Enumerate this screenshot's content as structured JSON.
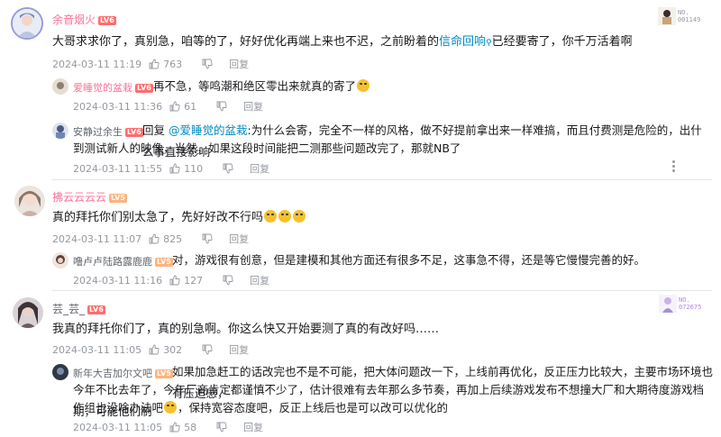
{
  "comments": [
    {
      "username": "余音烟火",
      "level": "LV6",
      "badge_no": "NO.\n001149",
      "text_before": "大哥求求你了，真别急，咱等的了，好好优化再端上来也不迟，之前盼着的",
      "link": "信命回响",
      "text_after": "已经要寄了，你千万活着啊",
      "time": "2024-03-11 11:19",
      "likes": "763",
      "reply": "回复",
      "replies": [
        {
          "username": "爱睡觉的盆栽",
          "level": "LV6",
          "text": "再不急，等鸣潮和绝区零出来就真的寄了",
          "time": "2024-03-11 11:36",
          "likes": "61",
          "reply": "回复"
        },
        {
          "username": "安静过余生",
          "level": "LV6",
          "prefix": "回复 ",
          "mention": "@爱睡觉的盆栽",
          "line1": ":为什么会寄，完全不一样的风格，做不好提前拿出来一样难搞，而且付费测是危险的，出什么事直接影响",
          "line2": "到测试新人的映像，当然，如果这段时间能把二测那些问题改完了，那就NB了",
          "time": "2024-03-11 11:55",
          "likes": "110",
          "reply": "回复"
        }
      ]
    },
    {
      "username": "拂云云云云",
      "level": "LV5",
      "text": "真的拜托你们别太急了，先好好改不行吗",
      "time": "2024-03-11 11:07",
      "likes": "825",
      "reply": "回复",
      "replies": [
        {
          "username": "噜卢卢陆路露鹿鹿",
          "level": "LV5",
          "text": "对，游戏很有创意，但是建模和其他方面还有很多不足，这事急不得，还是等它慢慢完善的好。",
          "time": "2024-03-11 11:16",
          "likes": "127",
          "reply": "回复"
        }
      ]
    },
    {
      "username": "芸_芸_",
      "level": "LV6",
      "badge_no": "NO.\n072675",
      "text": "我真的拜托你们了，真的别急啊。你这么快又开始要测了真的有改好吗……",
      "time": "2024-03-11 11:05",
      "likes": "302",
      "reply": "回复",
      "replies": [
        {
          "username": "新年大吉加尔文吧",
          "level": "LV5",
          "line1": "如果加急赶工的话改完也不是不可能，把大体问题改一下，上线前再优化，反正压力比较大，主要市场环境也有压迫感，",
          "line2": "今年不比去年了，今年厂商肯定都谨慎不少了，估计很难有去年那么多节奏，再加上后续游戏发布不想撞大厂和大期待度游戏档期，可能他们制",
          "line3_before": "作组也没啥办法吧",
          "line3_after": "，保持宽容态度吧，反正上线后也是可以改可以优化的",
          "time": "2024-03-11 11:05",
          "likes": "58",
          "reply": "回复"
        }
      ]
    }
  ],
  "colors": {
    "accent": "#fb7299",
    "link": "#008ac5",
    "meta": "#9499a0"
  }
}
